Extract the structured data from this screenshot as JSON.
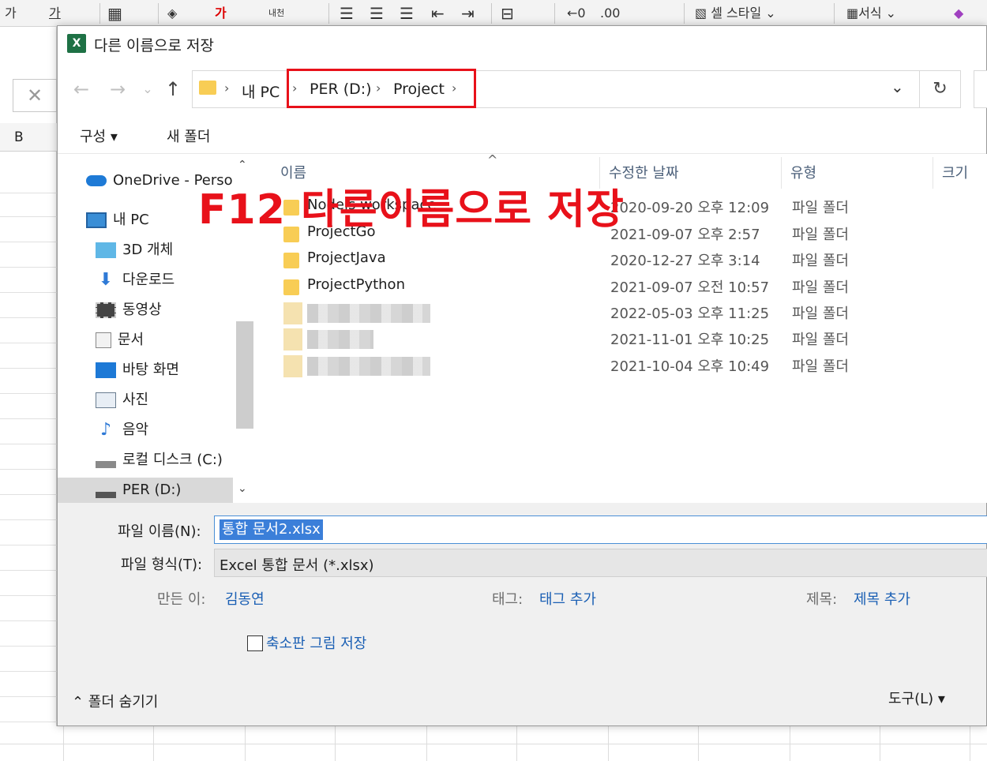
{
  "excel": {
    "ribbon": {
      "font_glyph_1": "가",
      "font_glyph_2": "가",
      "font_color_glyph": "가",
      "wrap_glyph": "내천",
      "cell_style": "셀 스타일",
      "format": "서식"
    },
    "column_b": "B",
    "cancel_glyph": "✕"
  },
  "dialog": {
    "title": "다른 이름으로 저장",
    "app_icon": "X",
    "nav": {
      "back_icon": "←",
      "forward_icon": "→",
      "recent_icon": "⌄",
      "up_icon": "↑"
    },
    "address": {
      "crumbs": [
        "내 PC",
        "PER (D:)",
        "Project"
      ],
      "separator": "›",
      "dropdown_icon": "⌄",
      "refresh_icon": "↻"
    },
    "toolbar": {
      "organize": "구성 ▾",
      "new_folder": "새 폴더"
    },
    "sidebar": {
      "items": [
        {
          "label": "OneDrive - Persol",
          "icon": "cloud-icon"
        },
        {
          "label": "내 PC",
          "icon": "pc-icon"
        },
        {
          "label": "3D 개체",
          "icon": "cube-icon"
        },
        {
          "label": "다운로드",
          "icon": "download-icon"
        },
        {
          "label": "동영상",
          "icon": "video-icon"
        },
        {
          "label": "문서",
          "icon": "document-icon"
        },
        {
          "label": "바탕 화면",
          "icon": "desktop-icon"
        },
        {
          "label": "사진",
          "icon": "picture-icon"
        },
        {
          "label": "음악",
          "icon": "music-icon"
        },
        {
          "label": "로컬 디스크 (C:)",
          "icon": "disk-icon"
        },
        {
          "label": "PER (D:)",
          "icon": "drive-icon"
        }
      ],
      "scroll_up": "⌃",
      "scroll_down": "⌄"
    },
    "columns": {
      "name": "이름",
      "modified": "수정한 날짜",
      "type": "유형",
      "size": "크기",
      "sort_indicator": "^"
    },
    "rows": [
      {
        "name": "Nodejs workspace",
        "modified": "2020-09-20 오후 12:09",
        "type": "파일 폴더"
      },
      {
        "name": "ProjectGo",
        "modified": "2021-09-07 오후 2:57",
        "type": "파일 폴더"
      },
      {
        "name": "ProjectJava",
        "modified": "2020-12-27 오후 3:14",
        "type": "파일 폴더"
      },
      {
        "name": "ProjectPython",
        "modified": "2021-09-07 오전 10:57",
        "type": "파일 폴더"
      },
      {
        "name": "",
        "modified": "2022-05-03 오후 11:25",
        "type": "파일 폴더"
      },
      {
        "name": "",
        "modified": "2021-11-01 오후 10:25",
        "type": "파일 폴더"
      },
      {
        "name": "",
        "modified": "2021-10-04 오후 10:49",
        "type": "파일 폴더"
      }
    ],
    "overlay_annotation": "F12 다른이름으로 저장",
    "form": {
      "filename_label": "파일 이름(N):",
      "filename_value": "통합 문서2.xlsx",
      "filetype_label": "파일 형식(T):",
      "filetype_value": "Excel 통합 문서 (*.xlsx)",
      "author_label": "만든 이:",
      "author_value": "김동연",
      "tags_label": "태그:",
      "tags_value": "태그 추가",
      "title_label": "제목:",
      "title_value": "제목 추가",
      "thumbnail_label": "축소판 그림 저장"
    },
    "footer": {
      "hide_folders": "⌃  폴더 숨기기",
      "tools": "도구(L)    ▾"
    }
  },
  "colors": {
    "annotation_red": "#e8111a",
    "folder_yellow": "#f8cd55",
    "link_blue": "#1a5fb4",
    "selection_blue": "#3b7fd9"
  }
}
